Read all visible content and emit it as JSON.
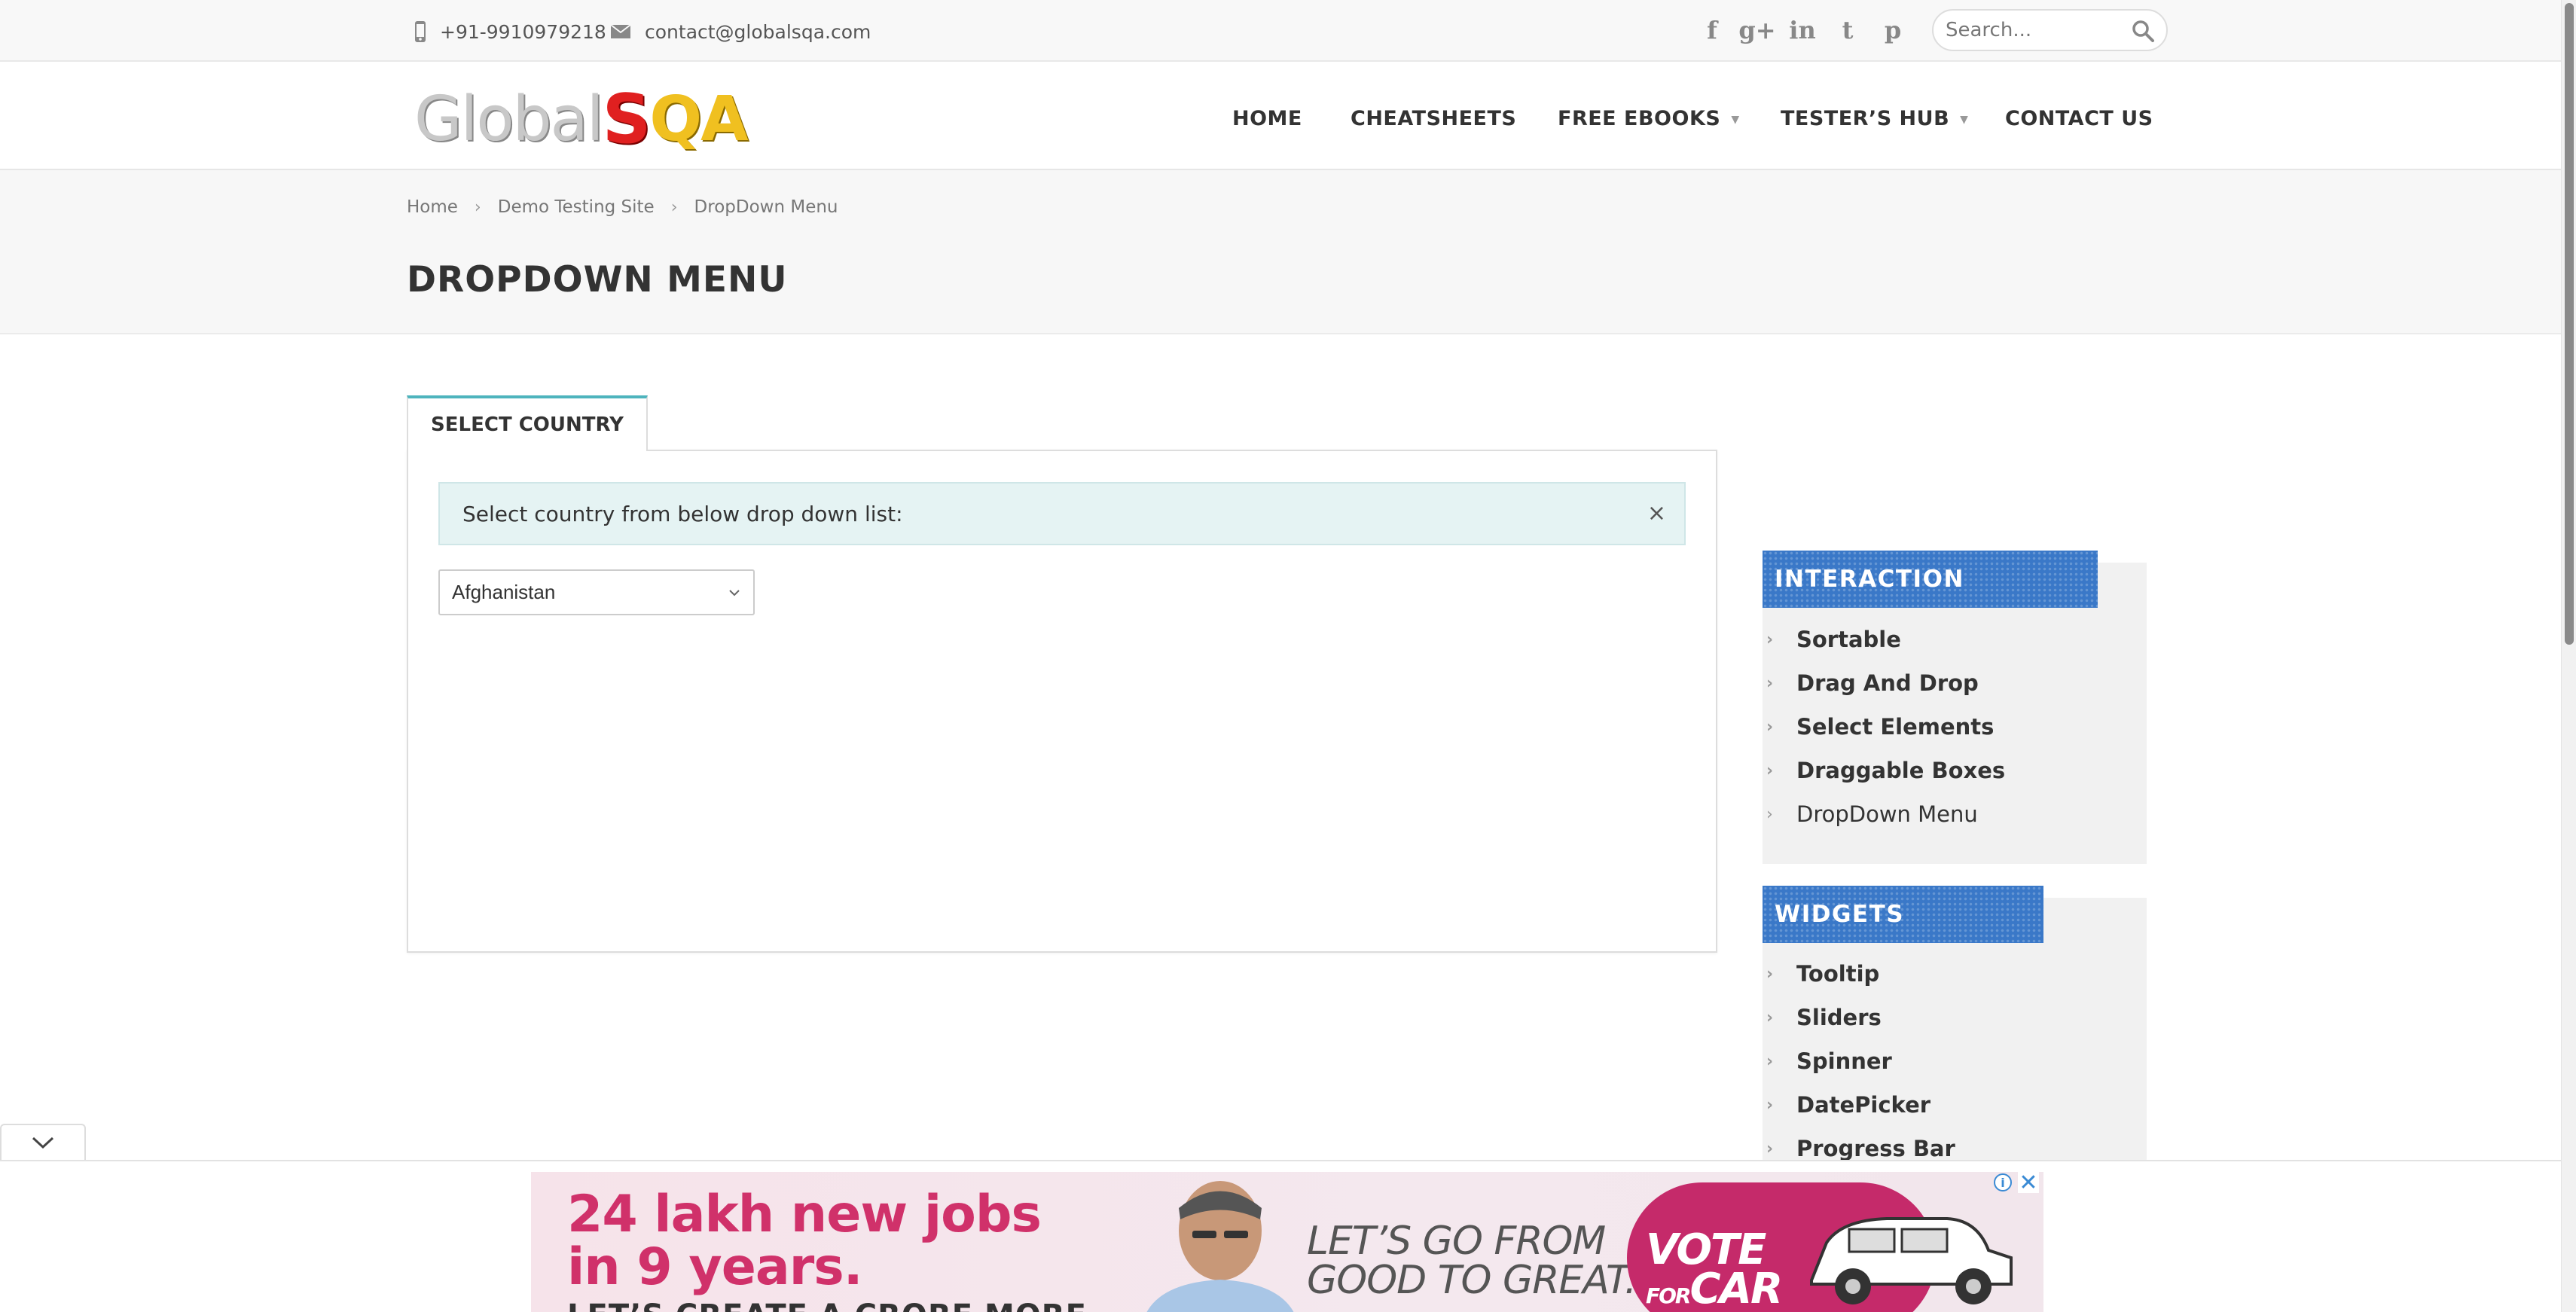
{
  "topbar": {
    "phone": "+91-9910979218",
    "email": "contact@globalsqa.com",
    "social_icons": [
      "facebook-icon",
      "google-plus-icon",
      "linkedin-icon",
      "twitter-icon",
      "pinterest-icon"
    ],
    "social_glyphs": [
      "f",
      "g+",
      "in",
      "t",
      "p"
    ],
    "search_placeholder": "Search..."
  },
  "logo": {
    "part1": "Global",
    "part2": "S",
    "part3": "QA"
  },
  "nav": {
    "home": "HOME",
    "cheatsheets": "CHEATSHEETS",
    "free_ebooks": "FREE EBOOKS",
    "testers_hub": "TESTER’S HUB",
    "contact_us": "CONTACT US"
  },
  "breadcrumb": [
    "Home",
    "Demo Testing Site",
    "DropDown Menu"
  ],
  "page_title": "DROPDOWN MENU",
  "main": {
    "tab_label": "SELECT COUNTRY",
    "info_text": "Select country from below drop down list:",
    "close_glyph": "×",
    "select_value": "Afghanistan"
  },
  "sidebar": {
    "interaction": {
      "title": "INTERACTION",
      "items": [
        "Sortable",
        "Drag And Drop",
        "Select Elements",
        "Draggable Boxes",
        "DropDown Menu"
      ],
      "current": "DropDown Menu"
    },
    "widgets": {
      "title": "WIDGETS",
      "items": [
        "Tooltip",
        "Sliders",
        "Spinner",
        "DatePicker",
        "Progress Bar"
      ]
    }
  },
  "ad": {
    "headline_line1": "24 lakh new jobs",
    "headline_line2": "in 9 years.",
    "headline_line3": "LET’S CREATE A CRORE MORE",
    "slogan_line1": "LET’S GO FROM",
    "slogan_line2": "GOOD TO GREAT.",
    "vote_line1": "VOTE",
    "vote_for": "FOR",
    "vote_car": "CAR",
    "info_glyph": "i",
    "close_glyph": "✕"
  },
  "colors": {
    "accent_teal": "#4eb4bd",
    "sidebar_header_blue": "#3a78c8",
    "info_bg": "#e5f3f3",
    "ad_pink": "#d0316a"
  }
}
